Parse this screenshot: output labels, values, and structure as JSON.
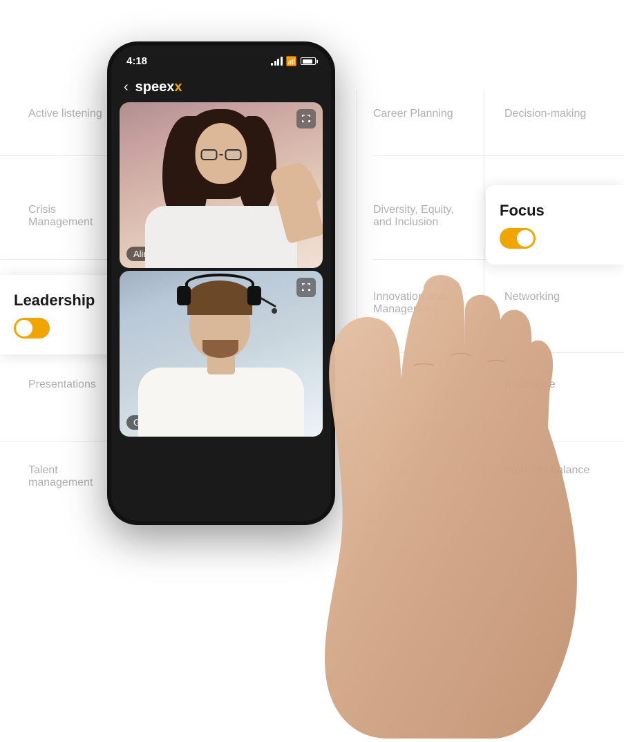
{
  "background_color": "#ffffff",
  "skills": {
    "active_listening": "Active listening",
    "career_planning": "Career Planning",
    "decision_making": "Decision-making",
    "crisis_management": "Crisis\nManagement",
    "diversity_equity_inclusion": "Diversity, Equity,\nand Inclusion",
    "leadership": "Leadership",
    "networking": "Networking",
    "presentations": "Presentations",
    "innovation_management": "Innovation and\nManagement",
    "resilience": "Resilience",
    "talent_management": "Talent\nmanagement",
    "work_life_balance": "Work-life balance"
  },
  "focus_card": {
    "title": "Focus",
    "toggle_state": true
  },
  "leadership_card": {
    "title": "Leadership",
    "toggle_state": true
  },
  "phone": {
    "status_bar": {
      "time": "4:18",
      "signal": true,
      "wifi": true,
      "battery": true
    },
    "header": {
      "back_label": "‹",
      "app_name_prefix": "speexx",
      "logo_char": "x"
    },
    "video_panels": [
      {
        "name": "Alina",
        "position": "top"
      },
      {
        "name": "Gabriel",
        "position": "bottom"
      }
    ]
  },
  "dividers": {
    "color": "#e8e8e8"
  },
  "accent_color": "#f0a500",
  "brand_color": "#1a1a1a"
}
